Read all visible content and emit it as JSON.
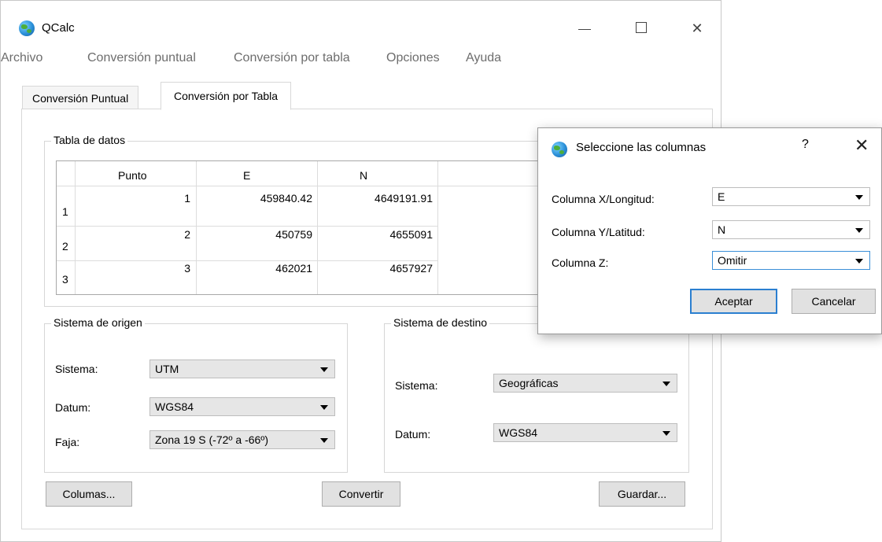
{
  "window": {
    "title": "QCalc",
    "controls": {
      "minimize": "minimize",
      "maximize": "maximize",
      "close": "✕"
    }
  },
  "menu": [
    "Archivo",
    "Conversión puntual",
    "Conversión por tabla",
    "Opciones",
    "Ayuda"
  ],
  "tabs": {
    "tab1": "Conversión Puntual",
    "tab2": "Conversión por Tabla",
    "active": "Conversión por Tabla"
  },
  "data_table": {
    "group_title": "Tabla de datos",
    "columns": [
      "Punto",
      "E",
      "N"
    ],
    "row_numbers": [
      "1",
      "2",
      "3"
    ],
    "rows": [
      [
        "1",
        "459840.42",
        "4649191.91"
      ],
      [
        "2",
        "450759",
        "4655091"
      ],
      [
        "3",
        "462021",
        "4657927"
      ]
    ]
  },
  "origin": {
    "group_title": "Sistema de origen",
    "sistema_label": "Sistema:",
    "sistema_value": "UTM",
    "datum_label": "Datum:",
    "datum_value": "WGS84",
    "faja_label": "Faja:",
    "faja_value": "Zona 19 S (-72º a -66º)"
  },
  "destination": {
    "group_title": "Sistema de destino",
    "sistema_label": "Sistema:",
    "sistema_value": "Geográficas",
    "datum_label": "Datum:",
    "datum_value": "WGS84"
  },
  "buttons": {
    "columns": "Columas...",
    "convert": "Convertir",
    "save": "Guardar..."
  },
  "dialog": {
    "title": "Seleccione las columnas",
    "help": "?",
    "close": "✕",
    "x_label": "Columna X/Longitud:",
    "x_value": "E",
    "y_label": "Columna Y/Latitud:",
    "y_value": "N",
    "z_label": "Columna Z:",
    "z_value": "Omitir",
    "accept": "Aceptar",
    "cancel": "Cancelar"
  },
  "colors": {
    "accent": "#3a8fd8",
    "menu_text": "#6d6d6d",
    "combo_bg": "#e6e6e6",
    "button_bg": "#e1e1e1"
  },
  "icons": {
    "app": "globe-icon",
    "dropdown": "chevron-down-icon"
  }
}
